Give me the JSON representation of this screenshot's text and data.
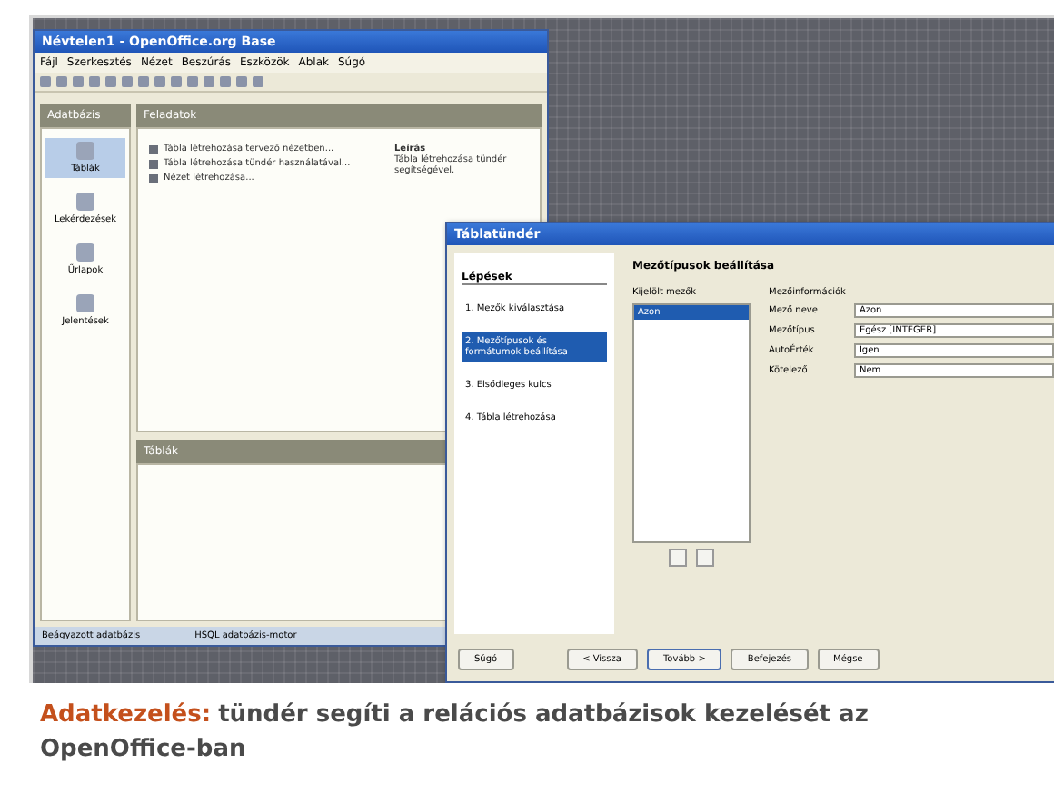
{
  "main_window": {
    "title": "Névtelen1 - OpenOffice.org Base",
    "menu": [
      "Fájl",
      "Szerkesztés",
      "Nézet",
      "Beszúrás",
      "Eszközök",
      "Ablak",
      "Súgó"
    ],
    "sidebar": {
      "title": "Adatbázis",
      "items": [
        {
          "label": "Táblák",
          "selected": true
        },
        {
          "label": "Lekérdezések",
          "selected": false
        },
        {
          "label": "Űrlapok",
          "selected": false
        },
        {
          "label": "Jelentések",
          "selected": false
        }
      ]
    },
    "tasks": {
      "title": "Feladatok",
      "items": [
        "Tábla létrehozása tervező nézetben...",
        "Tábla létrehozása tündér használatával...",
        "Nézet létrehozása..."
      ],
      "description_title": "Leírás",
      "description": "Tábla létrehozása tündér segítségével."
    },
    "lower_panel": {
      "title": "Táblák"
    },
    "status_bar": [
      "Beágyazott adatbázis",
      "HSQL adatbázis-motor"
    ]
  },
  "dialog": {
    "title": "Táblatündér",
    "steps_title": "Lépések",
    "steps": [
      {
        "label": "1. Mezők kiválasztása",
        "selected": false
      },
      {
        "label": "2. Mezőtípusok és formátumok beállítása",
        "selected": true
      },
      {
        "label": "3. Elsődleges kulcs",
        "selected": false
      },
      {
        "label": "4. Tábla létrehozása",
        "selected": false
      }
    ],
    "heading": "Mezőtípusok beállítása",
    "list_label": "Kijelölt mezők",
    "list": [
      {
        "label": "Azon",
        "selected": true
      }
    ],
    "props_title": "Mezőinformációk",
    "props": [
      {
        "label": "Mező neve",
        "value": "Azon"
      },
      {
        "label": "Mezőtípus",
        "value": "Egész [INTEGER]"
      },
      {
        "label": "AutoÉrték",
        "value": "Igen"
      },
      {
        "label": "Kötelező",
        "value": "Nem"
      }
    ],
    "buttons": [
      {
        "label": "Súgó",
        "kind": "left"
      },
      {
        "label": "< Vissza",
        "kind": "right"
      },
      {
        "label": "Tovább >",
        "kind": "default"
      },
      {
        "label": "Befejezés",
        "kind": "right"
      },
      {
        "label": "Mégse",
        "kind": "right"
      }
    ]
  },
  "caption": {
    "label": "Adatkezelés:",
    "text": "tündér segíti a relációs adatbázisok kezelését az OpenOffice-ban"
  }
}
